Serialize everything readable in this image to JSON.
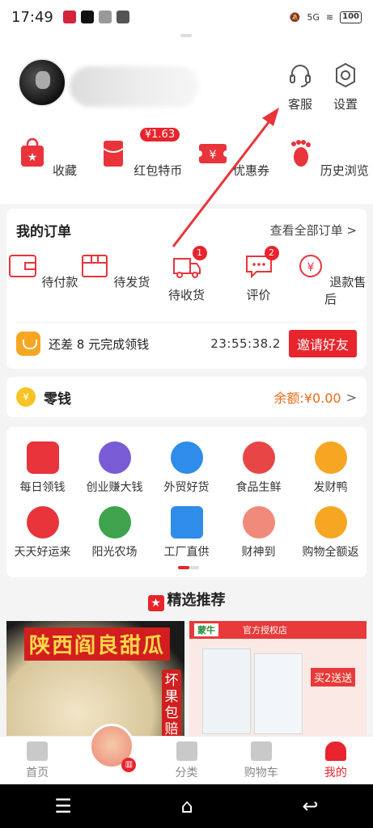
{
  "status": {
    "time": "17:49",
    "signal": "5G",
    "battery": "100"
  },
  "header": {
    "service": "客服",
    "settings": "设置"
  },
  "quick": [
    {
      "label": "收藏",
      "icon": "favorites-bag-icon"
    },
    {
      "label": "红包特币",
      "icon": "red-envelope-icon",
      "badge": "¥1.63"
    },
    {
      "label": "优惠券",
      "icon": "coupon-icon"
    },
    {
      "label": "历史浏览",
      "icon": "footprint-icon"
    }
  ],
  "orders": {
    "title": "我的订单",
    "all": "查看全部订单 >",
    "items": [
      {
        "label": "待付款",
        "icon": "wallet-icon"
      },
      {
        "label": "待发货",
        "icon": "package-icon"
      },
      {
        "label": "待收货",
        "icon": "truck-icon",
        "count": "1"
      },
      {
        "label": "评价",
        "icon": "comment-icon",
        "count": "2"
      },
      {
        "label": "退款售后",
        "icon": "refund-icon"
      }
    ],
    "invite": {
      "text": "还差 8 元完成领钱",
      "timer": "23:55:38.2",
      "button": "邀请好友"
    }
  },
  "wallet": {
    "coin": "¥",
    "title": "零钱",
    "balance": "余额:¥0.00",
    "chev": ">"
  },
  "services": [
    {
      "label": "每日领钱",
      "color": "#e8343a"
    },
    {
      "label": "创业赚大钱",
      "color": "#7a5bd6"
    },
    {
      "label": "外贸好货",
      "color": "#2f8ce8"
    },
    {
      "label": "食品生鲜",
      "color": "#e84545"
    },
    {
      "label": "发财鸭",
      "color": "#f6a623"
    },
    {
      "label": "天天好运来",
      "color": "#e8343a"
    },
    {
      "label": "阳光农场",
      "color": "#3fa34d"
    },
    {
      "label": "工厂直供",
      "color": "#2f8ce8"
    },
    {
      "label": "财神到",
      "color": "#f08a7a"
    },
    {
      "label": "购物全额返",
      "color": "#f6a623"
    }
  ],
  "recommend": {
    "title": "精选推荐",
    "star": "★"
  },
  "products": [
    {
      "title": "陕西阎良甜瓜",
      "tag": "坏果包赔"
    },
    {
      "brand": "蒙牛",
      "store": "官方授权店",
      "promo": "买2送送"
    }
  ],
  "tabs": [
    {
      "label": "首页",
      "active": false
    },
    {
      "label": "",
      "active": false
    },
    {
      "label": "分类",
      "active": false
    },
    {
      "label": "购物车",
      "active": false
    },
    {
      "label": "我的",
      "active": true
    }
  ],
  "nav": {
    "menu": "☰",
    "home": "⌂",
    "back": "↩"
  }
}
